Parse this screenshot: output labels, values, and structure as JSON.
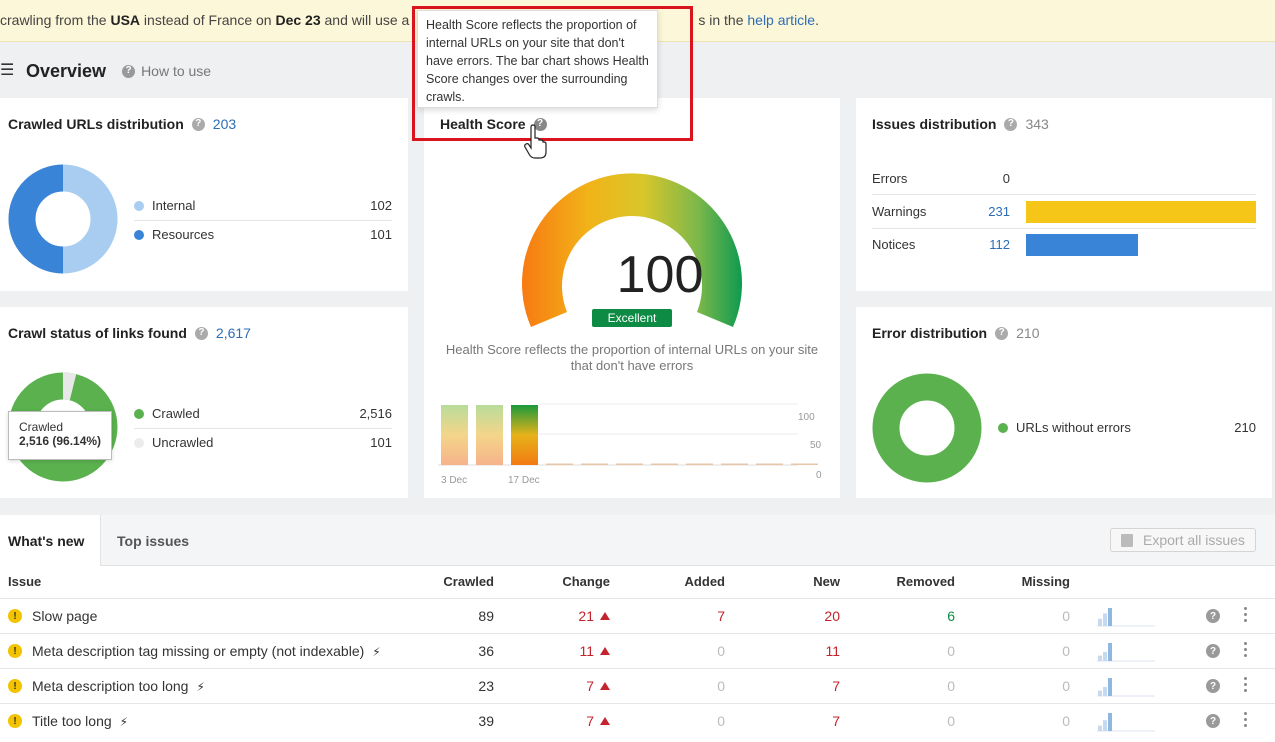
{
  "banner": {
    "text_1": "crawling from the ",
    "bold_1": "USA",
    "text_2": " instead of France on ",
    "bold_2": "Dec 23",
    "text_3": " and will use a",
    "text_4": "s in the ",
    "link": "help article",
    "text_5": "."
  },
  "header": {
    "title": "Overview",
    "how_to_use": "How to use"
  },
  "crawled_urls": {
    "title": "Crawled URLs distribution",
    "count": "203",
    "items": [
      {
        "label": "Internal",
        "value": "102",
        "color": "#a9cdf0"
      },
      {
        "label": "Resources",
        "value": "101",
        "color": "#3984d6"
      }
    ]
  },
  "crawl_status": {
    "title": "Crawl status of links found",
    "count": "2,617",
    "items": [
      {
        "label": "Crawled",
        "value": "2,516",
        "color": "#5ab14e"
      },
      {
        "label": "Uncrawled",
        "value": "101",
        "color": "#e8e8e8"
      }
    ],
    "tooltip_label": "Crawled",
    "tooltip_value": "2,516 (96.14%)"
  },
  "health_score": {
    "title": "Health Score",
    "tooltip": "Health Score reflects the proportion of internal URLs on your site that don't have errors. The bar chart shows Health Score changes over the surrounding crawls.",
    "score": "100",
    "rating": "Excellent",
    "description": "Health Score reflects the proportion of internal URLs on your site that don't have errors",
    "chart": {
      "y_ticks": [
        "100",
        "50",
        "0"
      ],
      "x_labels": [
        "3 Dec",
        "17 Dec"
      ],
      "values": [
        100,
        100,
        100,
        0,
        0,
        0,
        0,
        0,
        0,
        0,
        0
      ]
    }
  },
  "issues_distribution": {
    "title": "Issues distribution",
    "count": "343",
    "items": [
      {
        "label": "Errors",
        "value": "0",
        "color": "#d9141c",
        "fraction": 0
      },
      {
        "label": "Warnings",
        "value": "231",
        "color": "#f5c518",
        "fraction": 1.0
      },
      {
        "label": "Notices",
        "value": "112",
        "color": "#3984d6",
        "fraction": 0.485
      }
    ]
  },
  "error_distribution": {
    "title": "Error distribution",
    "count": "210",
    "items": [
      {
        "label": "URLs without errors",
        "value": "210",
        "color": "#5ab14e"
      }
    ]
  },
  "tabs": {
    "whats_new": "What's new",
    "top_issues": "Top issues",
    "export": "Export all issues"
  },
  "table": {
    "headers": [
      "Issue",
      "Crawled",
      "Change",
      "Added",
      "New",
      "Removed",
      "Missing"
    ],
    "rows": [
      {
        "issue": "Slow page",
        "bolt": false,
        "crawled": "89",
        "change": "21",
        "added": "7",
        "new": "20",
        "removed": "6",
        "missing": "0",
        "spark": [
          0.4,
          0.7,
          1.0
        ]
      },
      {
        "issue": "Meta description tag missing or empty (not indexable)",
        "bolt": true,
        "crawled": "36",
        "change": "11",
        "added": "0",
        "new": "11",
        "removed": "0",
        "missing": "0",
        "spark": [
          0.3,
          0.5,
          1.0
        ]
      },
      {
        "issue": "Meta description too long",
        "bolt": true,
        "crawled": "23",
        "change": "7",
        "added": "0",
        "new": "7",
        "removed": "0",
        "missing": "0",
        "spark": [
          0.3,
          0.5,
          1.0
        ]
      },
      {
        "issue": "Title too long",
        "bolt": true,
        "crawled": "39",
        "change": "7",
        "added": "0",
        "new": "7",
        "removed": "0",
        "missing": "0",
        "spark": [
          0.3,
          0.6,
          1.0
        ]
      }
    ]
  }
}
